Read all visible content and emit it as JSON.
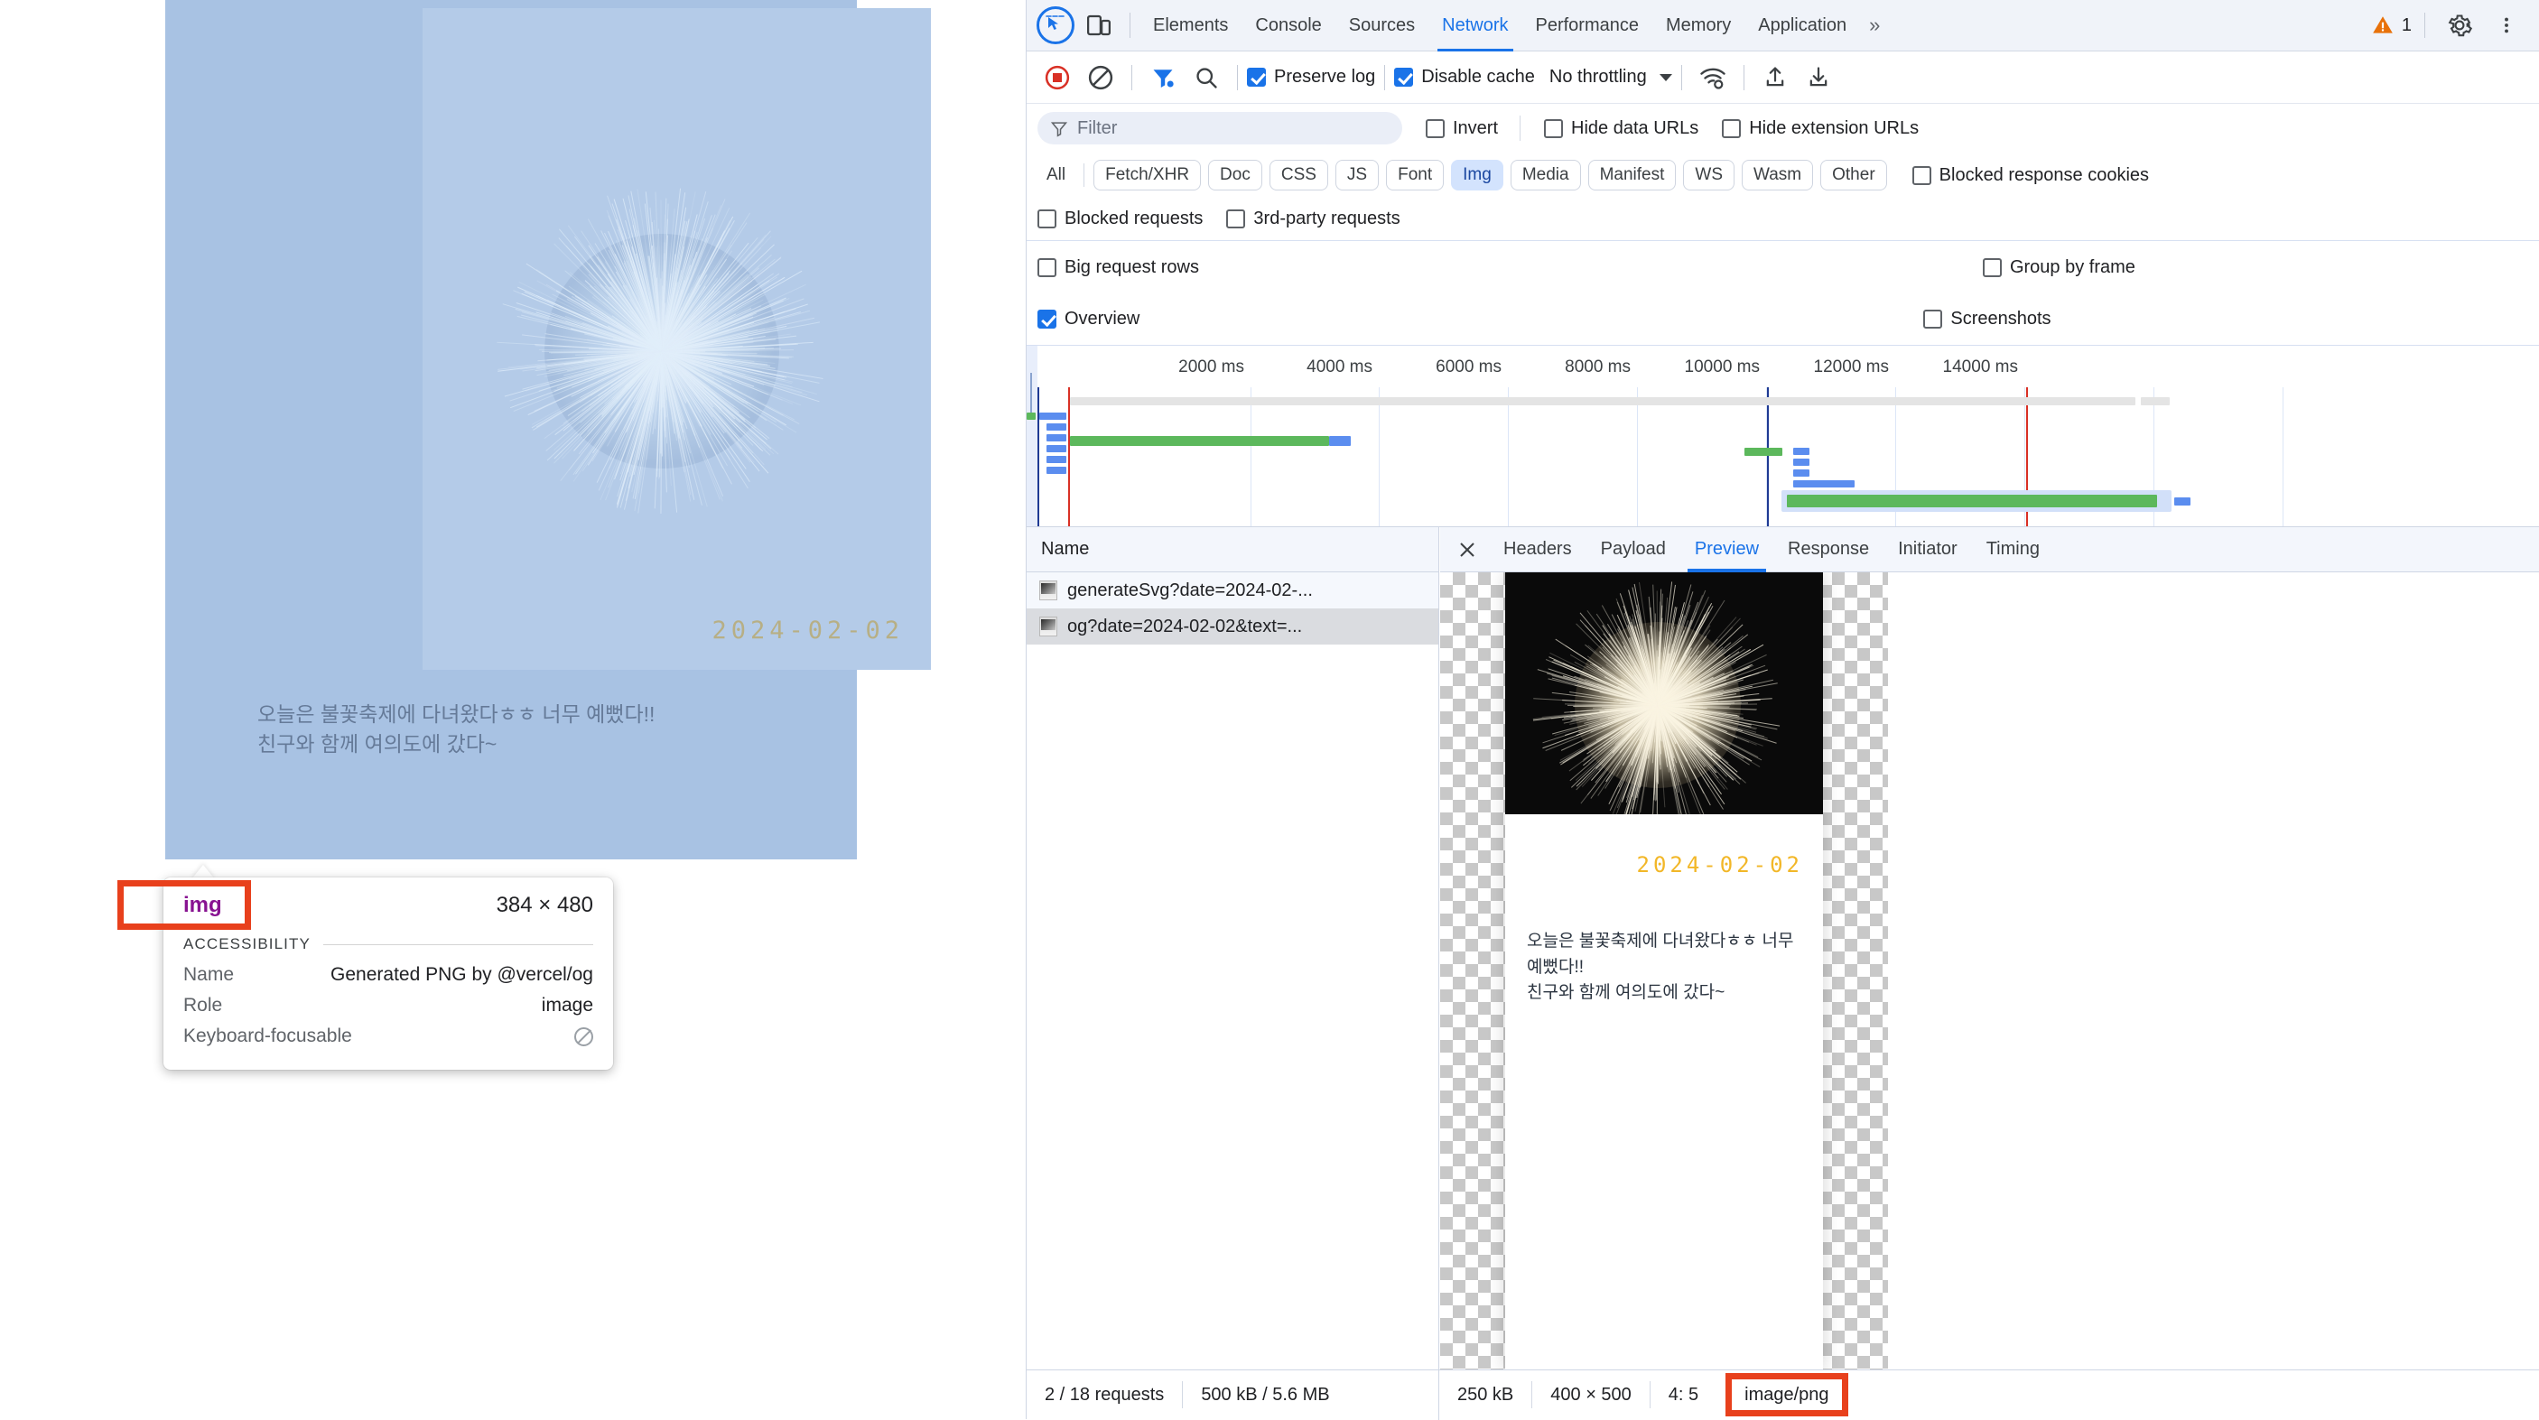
{
  "page": {
    "polaroid_date": "2024-02-02",
    "caption_line1": "오늘은 불꽃축제에 다녀왔다ㅎㅎ 너무 예뻤다!!",
    "caption_line2": "친구와 함께 여의도에 갔다~"
  },
  "a11y_tooltip": {
    "tag": "img",
    "dimensions": "384 × 480",
    "section_label": "ACCESSIBILITY",
    "rows": [
      {
        "key": "Name",
        "value": "Generated PNG by @vercel/og"
      },
      {
        "key": "Role",
        "value": "image"
      },
      {
        "key": "Keyboard-focusable",
        "value": ""
      }
    ],
    "highlight_color": "#e8401c"
  },
  "devtools": {
    "tabs": [
      {
        "label": "Elements",
        "active": false
      },
      {
        "label": "Console",
        "active": false
      },
      {
        "label": "Sources",
        "active": false
      },
      {
        "label": "Network",
        "active": true
      },
      {
        "label": "Performance",
        "active": false
      },
      {
        "label": "Memory",
        "active": false
      },
      {
        "label": "Application",
        "active": false
      }
    ],
    "more_tabs": "»",
    "warning_count": "1",
    "accent_color": "#1a73e8",
    "toolbar": {
      "preserve_log": {
        "label": "Preserve log",
        "checked": true
      },
      "disable_cache": {
        "label": "Disable cache",
        "checked": true
      },
      "throttling": "No throttling"
    },
    "filter": {
      "placeholder": "Filter",
      "value": "",
      "invert": {
        "label": "Invert",
        "checked": false
      },
      "hide_data_urls": {
        "label": "Hide data URLs",
        "checked": false
      },
      "hide_extension_urls": {
        "label": "Hide extension URLs",
        "checked": false
      }
    },
    "type_chips": [
      {
        "label": "All",
        "selected": false
      },
      {
        "label": "Fetch/XHR",
        "selected": false
      },
      {
        "label": "Doc",
        "selected": false
      },
      {
        "label": "CSS",
        "selected": false
      },
      {
        "label": "JS",
        "selected": false
      },
      {
        "label": "Font",
        "selected": false
      },
      {
        "label": "Img",
        "selected": true
      },
      {
        "label": "Media",
        "selected": false
      },
      {
        "label": "Manifest",
        "selected": false
      },
      {
        "label": "WS",
        "selected": false
      },
      {
        "label": "Wasm",
        "selected": false
      },
      {
        "label": "Other",
        "selected": false
      }
    ],
    "blocked_response_cookies": {
      "label": "Blocked response cookies",
      "checked": false
    },
    "blocked_requests": {
      "label": "Blocked requests",
      "checked": false
    },
    "third_party_requests": {
      "label": "3rd-party requests",
      "checked": false
    },
    "big_request_rows": {
      "label": "Big request rows",
      "checked": false
    },
    "group_by_frame": {
      "label": "Group by frame",
      "checked": false
    },
    "overview_toggle": {
      "label": "Overview",
      "checked": true
    },
    "screenshots_toggle": {
      "label": "Screenshots",
      "checked": false
    },
    "timeline": {
      "ticks": [
        "2000 ms",
        "4000 ms",
        "6000 ms",
        "8000 ms",
        "10000 ms",
        "12000 ms",
        "14000 ms"
      ]
    },
    "name_column_header": "Name",
    "requests": [
      {
        "name": "generateSvg?date=2024-02-...",
        "selected": false
      },
      {
        "name": "og?date=2024-02-02&text=...",
        "selected": true
      }
    ],
    "detail_tabs": [
      {
        "label": "Headers",
        "active": false
      },
      {
        "label": "Payload",
        "active": false
      },
      {
        "label": "Preview",
        "active": true
      },
      {
        "label": "Response",
        "active": false
      },
      {
        "label": "Initiator",
        "active": false
      },
      {
        "label": "Timing",
        "active": false
      }
    ],
    "preview": {
      "date": "2024-02-02",
      "caption_line1": "오늘은 불꽃축제에 다녀왔다ㅎㅎ 너무 예뻤다!!",
      "caption_line2": "친구와 함께 여의도에 갔다~"
    },
    "statusbar": {
      "requests": "2 / 18 requests",
      "transferred": "500 kB / 5.6 MB",
      "resource_size": "250 kB",
      "dimensions": "400 × 500",
      "ratio": "4: 5",
      "mime_type": "image/png",
      "mime_highlight_color": "#e8401c"
    }
  }
}
